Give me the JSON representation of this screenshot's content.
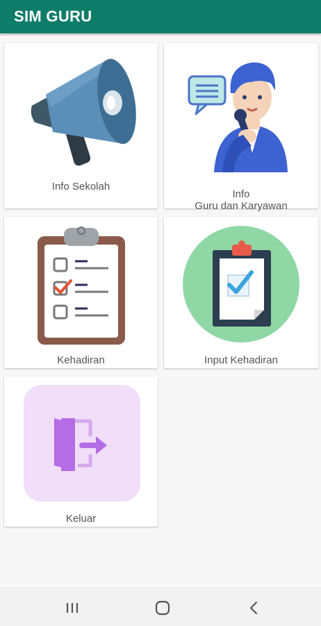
{
  "app": {
    "title": "SIM GURU"
  },
  "menu": {
    "info_sekolah": "Info Sekolah",
    "info_guru_line1": "Info",
    "info_guru_line2": "Guru dan Karyawan",
    "kehadiran": "Kehadiran",
    "input_kehadiran": "Input Kehadiran",
    "keluar": "Keluar"
  },
  "icons": {
    "info_sekolah": "megaphone-icon",
    "info_guru": "speaker-person-icon",
    "kehadiran": "clipboard-checklist-icon",
    "input_kehadiran": "clipboard-check-icon",
    "keluar": "exit-door-icon"
  },
  "colors": {
    "app_bar": "#0d7c68",
    "title_text": "#ffffff",
    "label_text": "#555555"
  },
  "navbar": {
    "recents": "recents-icon",
    "home": "home-icon",
    "back": "back-icon"
  }
}
